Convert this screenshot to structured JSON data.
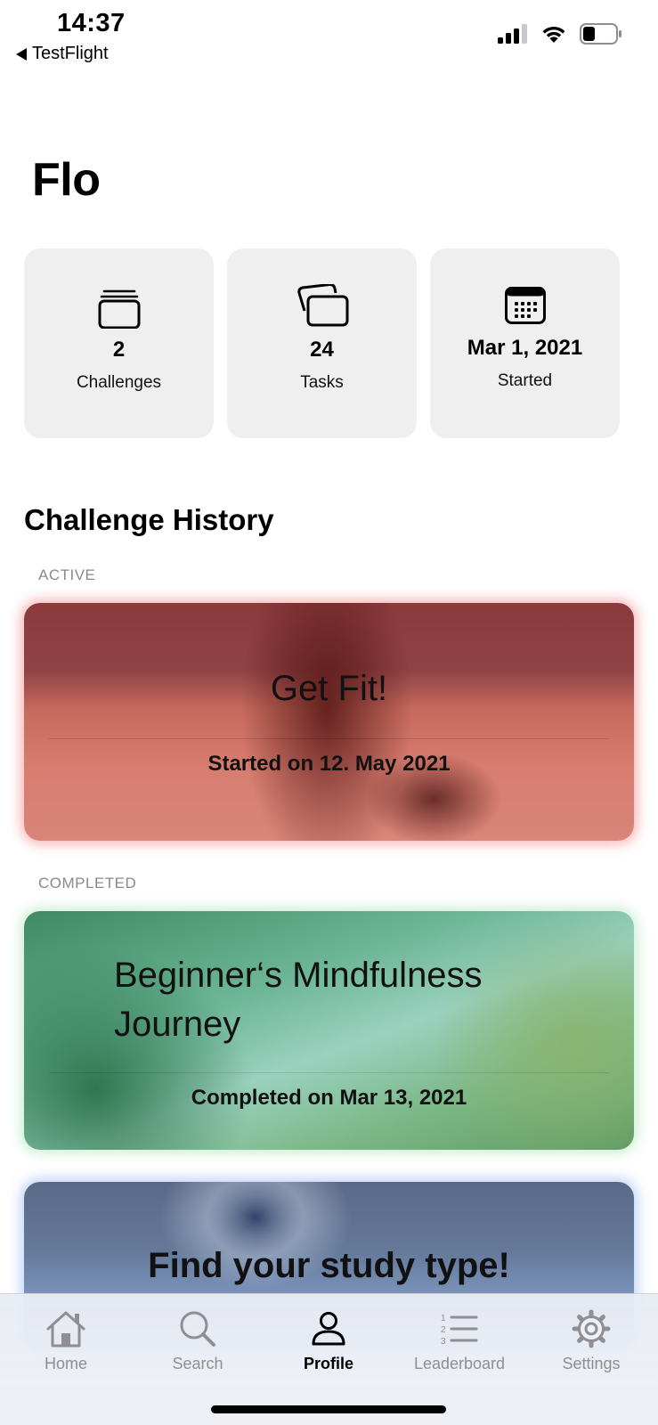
{
  "status_bar": {
    "time": "14:37",
    "back_label": "TestFlight",
    "icons": [
      "signal-icon",
      "wifi-icon",
      "battery-icon"
    ]
  },
  "page_title": "Flo",
  "stats": [
    {
      "value": "2",
      "label": "Challenges",
      "icon": "stack-icon"
    },
    {
      "value": "24",
      "label": "Tasks",
      "icon": "cards-icon"
    },
    {
      "value": "Mar 1, 2021",
      "label": "Started",
      "icon": "calendar-icon"
    }
  ],
  "history": {
    "title": "Challenge History",
    "active_label": "ACTIVE",
    "completed_label": "COMPLETED",
    "cards": [
      {
        "title": "Get Fit!",
        "subtitle": "Started on 12. May 2021",
        "glow": "#f05a5a"
      },
      {
        "title_line1": "Beginner‘s Mindfulness",
        "title_line2": "Journey",
        "subtitle": "Completed on Mar 13, 2021",
        "glow": "#8cdca0"
      },
      {
        "title": "Find your study type!",
        "glow": "#82aaf0"
      }
    ]
  },
  "tab_bar": {
    "active": "Profile",
    "items": [
      {
        "label": "Home",
        "icon": "house-icon"
      },
      {
        "label": "Search",
        "icon": "magnifier-icon"
      },
      {
        "label": "Profile",
        "icon": "person-icon"
      },
      {
        "label": "Leaderboard",
        "icon": "numbered-list-icon"
      },
      {
        "label": "Settings",
        "icon": "gear-icon"
      }
    ]
  }
}
